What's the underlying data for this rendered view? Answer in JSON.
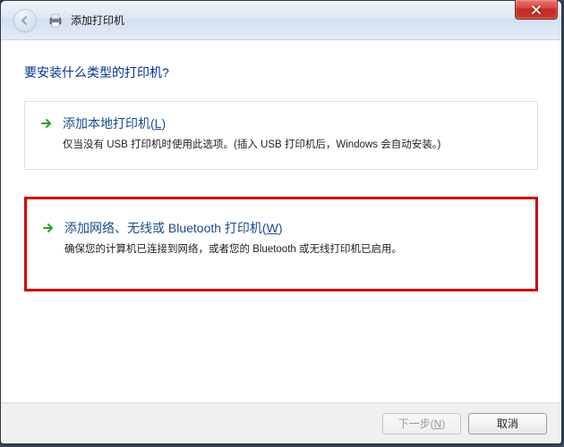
{
  "window": {
    "title": "添加打印机"
  },
  "main": {
    "heading": "要安装什么类型的打印机?",
    "options": [
      {
        "title_prefix": "添加本地打印机(",
        "title_key": "L",
        "title_suffix": ")",
        "desc": "仅当没有 USB 打印机时使用此选项。(插入 USB 打印机后，Windows 会自动安装。)"
      },
      {
        "title_prefix": "添加网络、无线或 Bluetooth 打印机(",
        "title_key": "W",
        "title_suffix": ")",
        "desc": "确保您的计算机已连接到网络，或者您的 Bluetooth 或无线打印机已启用。"
      }
    ]
  },
  "footer": {
    "next_prefix": "下一步(",
    "next_key": "N",
    "next_suffix": ")",
    "cancel": "取消"
  }
}
